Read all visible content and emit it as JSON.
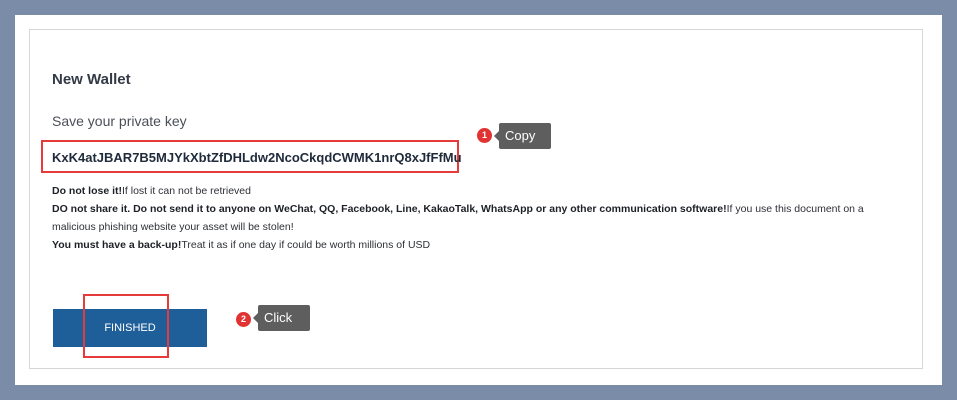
{
  "card": {
    "title": "New Wallet",
    "subtitle": "Save your private key",
    "private_key": "KxK4atJBAR7B5MJYkXbtZfDHLdw2NcoCkqdCWMK1nrQ8xJfFfMu"
  },
  "warnings": {
    "line1_bold": "Do not lose it!",
    "line1_text": "If lost it can not be retrieved",
    "line2_bold": "DO not share it. Do not send it to anyone on WeChat, QQ, Facebook, Line, KakaoTalk, WhatsApp or any other communication software!",
    "line2_text": "If you use this document on a malicious phishing website your asset will be stolen!",
    "line3_bold": "You must have a back-up!",
    "line3_text": "Treat it as if one day if could be worth millions of USD"
  },
  "button": {
    "finished_label": "FINISHED"
  },
  "annotations": {
    "copy_number": "1",
    "copy_label": "Copy",
    "click_number": "2",
    "click_label": "Click",
    "highlight_color": "#e53b3b",
    "button_color": "#1f5f99"
  }
}
